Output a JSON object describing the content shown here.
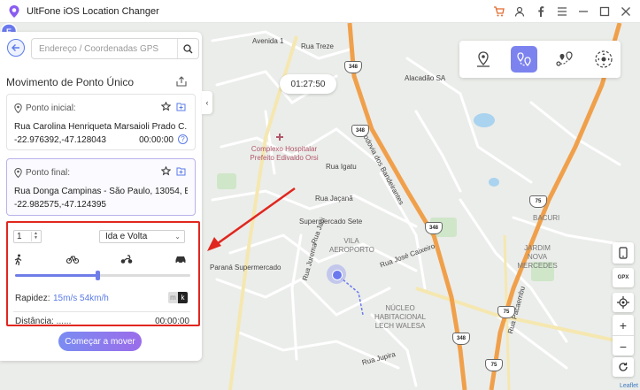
{
  "app": {
    "title": "UltFone iOS Location Changer"
  },
  "search": {
    "placeholder": "Endereço / Coordenadas GPS"
  },
  "panel": {
    "title": "Movimento de Ponto Único",
    "start": {
      "label": "Ponto inicial:",
      "address": "Rua Carolina Henriqueta Marsaioli Prado C...",
      "coords": "-22.976392,-47.128043",
      "time": "00:00:00"
    },
    "end": {
      "label": "Ponto final:",
      "address": "Rua Donga Campinas - São Paulo, 13054, B...",
      "coords": "-22.982575,-47.124395"
    },
    "settings": {
      "count": "1",
      "mode": "Ida e Volta",
      "speed_label": "Rapidez:",
      "speed_value": "15m/s 54km/h",
      "unit_m": "m",
      "unit_k": "k",
      "speed_fraction": 0.47,
      "distance_label": "Distância: ......",
      "distance_time": "00:00:00"
    },
    "start_button": "Começar a mover"
  },
  "timer": "01:27:50",
  "map": {
    "labels": {
      "avenida1": "Avenida 1",
      "rua_treze": "Rua Treze",
      "alacadao": "Alacadão SA",
      "complexo": "Complexo Hospitalar",
      "prefeito": "Prefeito Edivaldo Orsi",
      "rodovia": "Rodovia dos Bandeirantes",
      "rua_igatu": "Rua Igatu",
      "rua_jacana": "Rua Jaçanã",
      "supermercado_sete": "Supermercado Sete",
      "rua_jaci": "Rua Jaci",
      "vila": "VILA",
      "aeroporto": "AEROPORTO",
      "rua_jose_caixeiro": "Rua José Caixeiro",
      "parana": "Paraná Supermercado",
      "rua_jurema": "Rua Jurema",
      "rua_jupira": "Rua Jupira",
      "nucleo": "NÚCLEO",
      "habitacional": "HABITACIONAL",
      "lech": "LECH WALESA",
      "bacuri": "BACURI",
      "jardim": "JARDIM",
      "nova": "NOVA",
      "mercedes": "MERCEDES",
      "rua_pacaembu": "Rua Pacaembu",
      "shield_348a": "348",
      "shield_348b": "348",
      "shield_348c": "348",
      "shield_348d": "348",
      "shield_75a": "75",
      "shield_75b": "75",
      "shield_75c": "75",
      "marker_e": "E"
    },
    "gpx": "GPX",
    "zoom_in": "+",
    "zoom_out": "−",
    "attribution": "Leaflet"
  },
  "colors": {
    "accent": "#7c83ef",
    "highway": "#f0a04b",
    "highlight": "#e0271f"
  }
}
